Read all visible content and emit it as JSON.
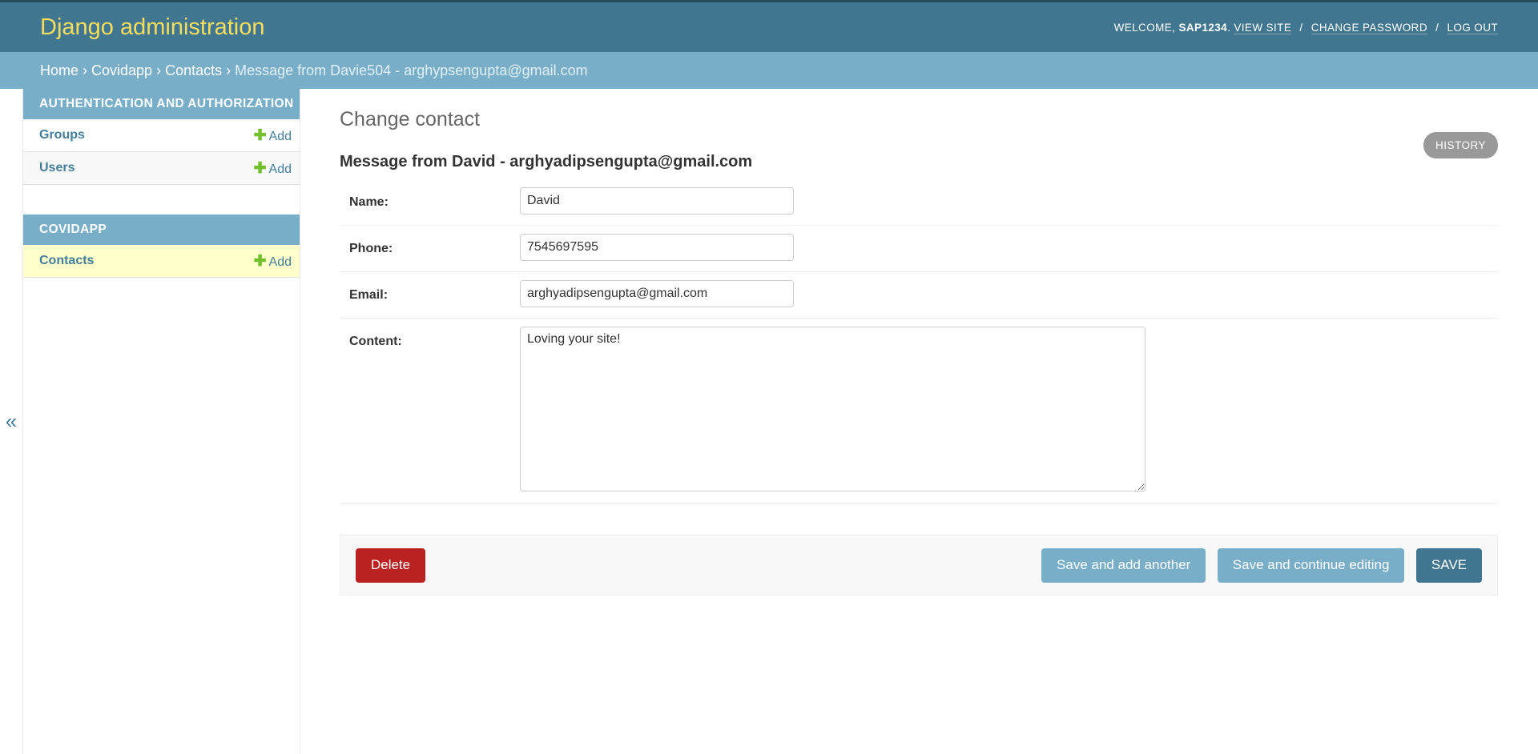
{
  "header": {
    "title": "Django administration",
    "welcome": "WELCOME,",
    "username": "SAP1234",
    "links": {
      "view_site": "VIEW SITE",
      "change_password": "CHANGE PASSWORD",
      "log_out": "LOG OUT"
    },
    "separator": "/"
  },
  "breadcrumbs": {
    "items": [
      "Home",
      "Covidapp",
      "Contacts"
    ],
    "arrow": "›",
    "current": "Message from Davie504 - arghypsengupta@gmail.com"
  },
  "sidebar": {
    "toggle": "«",
    "modules": [
      {
        "caption": "Authentication and Authorization",
        "rows": [
          {
            "label": "Groups",
            "add": "Add"
          },
          {
            "label": "Users",
            "add": "Add"
          }
        ]
      },
      {
        "caption": "Covidapp",
        "rows": [
          {
            "label": "Contacts",
            "add": "Add"
          }
        ]
      }
    ]
  },
  "content": {
    "title": "Change contact",
    "history": "HISTORY",
    "object_title": "Message from David - arghyadipsengupta@gmail.com",
    "fields": {
      "name": {
        "label": "Name:",
        "value": "David"
      },
      "phone": {
        "label": "Phone:",
        "value": "7545697595"
      },
      "email": {
        "label": "Email:",
        "value": "arghyadipsengupta@gmail.com"
      },
      "content": {
        "label": "Content:",
        "value": "Loving your site!"
      }
    },
    "buttons": {
      "delete": "Delete",
      "save_add_another": "Save and add another",
      "save_continue": "Save and continue editing",
      "save": "SAVE"
    }
  },
  "colors": {
    "header_bg": "#417690",
    "branding": "#f5dd5d",
    "breadcrumb_bg": "#79aec8",
    "delete": "#ba2121",
    "add_plus": "#70bf2b",
    "current_row": "#ffffcc"
  },
  "icons": {
    "toggle": "double-chevron-left-icon",
    "add": "plus-icon"
  }
}
